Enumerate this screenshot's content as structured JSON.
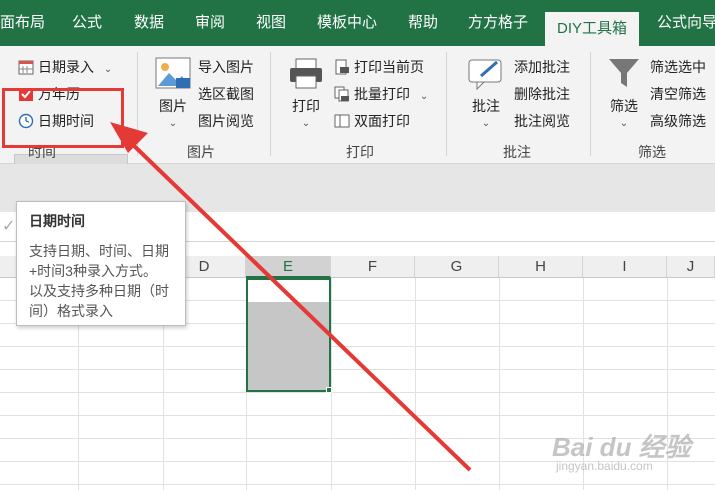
{
  "tabs": [
    "面布局",
    "公式",
    "数据",
    "审阅",
    "视图",
    "模板中心",
    "帮助",
    "方方格子",
    "DIY工具箱",
    "公式向导"
  ],
  "active_tab": "DIY工具箱",
  "ribbon": {
    "time_group": {
      "items": [
        "日期录入",
        "万年历",
        "日期时间"
      ],
      "label": "时间",
      "dropdown_glyph": "⌄"
    },
    "picture_group": {
      "big_button": "图片",
      "items": [
        "导入图片",
        "选区截图",
        "图片阅览"
      ],
      "label": "图片"
    },
    "print_group": {
      "big_button": "打印",
      "items": [
        "打印当前页",
        "批量打印",
        "双面打印"
      ],
      "label": "打印"
    },
    "comment_group": {
      "big_button": "批注",
      "items": [
        "添加批注",
        "删除批注",
        "批注阅览"
      ],
      "label": "批注"
    },
    "filter_group": {
      "big_button": "筛选",
      "items": [
        "筛选选中",
        "清空筛选",
        "高级筛选"
      ],
      "label": "筛选"
    },
    "dropdown_chevron": "⌄"
  },
  "columns": [
    "D",
    "E",
    "F",
    "G",
    "H",
    "I",
    "J"
  ],
  "selected_column": "E",
  "tooltip": {
    "title": "日期时间",
    "lines": [
      "支持日期、时间、日期",
      "+时间3种录入方式。",
      "以及支持多种日期（时",
      "间）格式录入"
    ]
  },
  "formula_check_glyph": "✓",
  "colors": {
    "excel_green": "#217346",
    "annotation_red": "#e53935"
  },
  "watermark": {
    "main": "Bai du 经验",
    "sub": "jingyan.baidu.com"
  }
}
